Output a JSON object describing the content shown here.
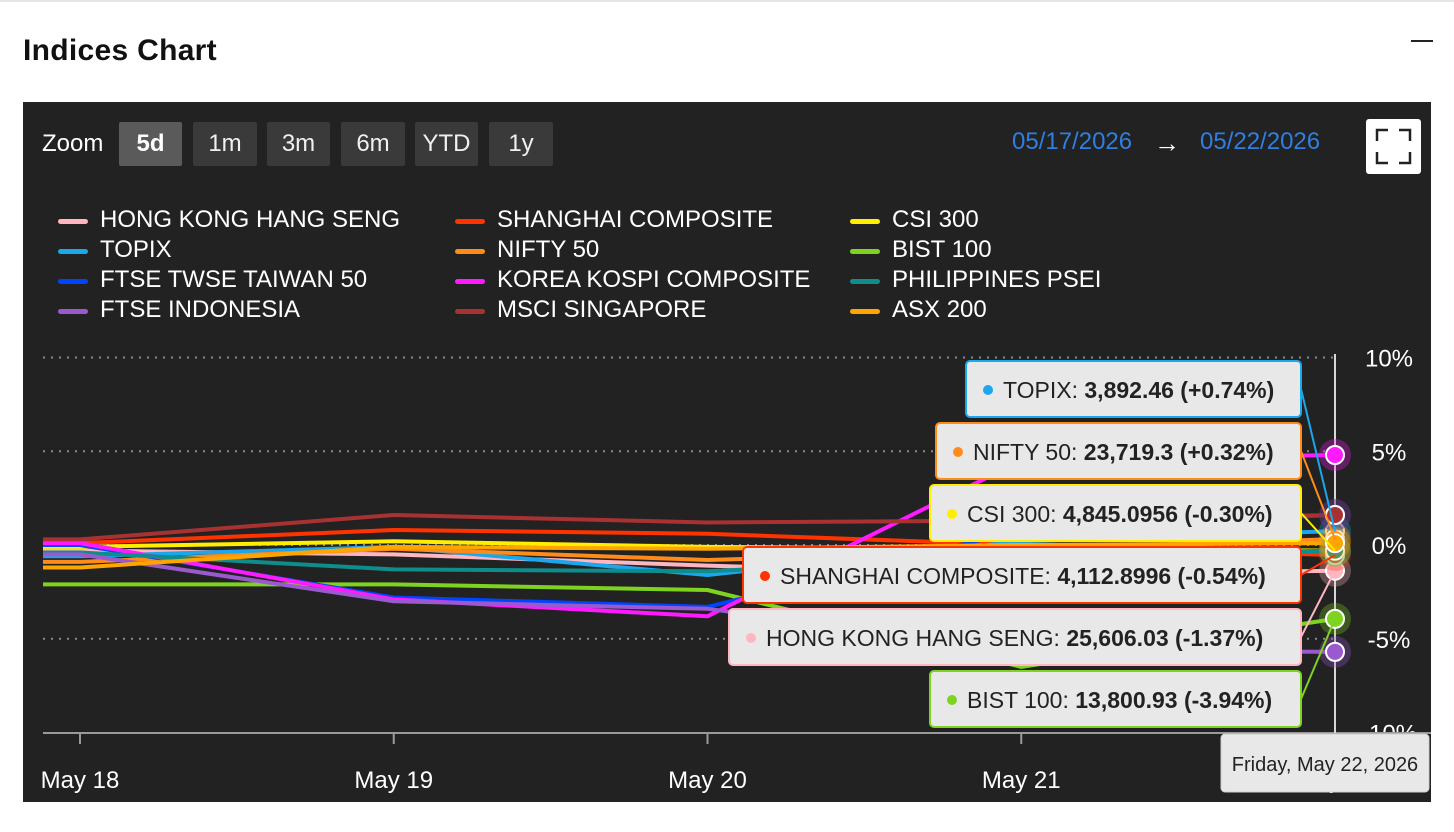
{
  "widget": {
    "title": "Indices Chart"
  },
  "zoom": {
    "label": "Zoom",
    "buttons": [
      "5d",
      "1m",
      "3m",
      "6m",
      "YTD",
      "1y"
    ],
    "active": "5d"
  },
  "date_range": {
    "from": "05/17/2026",
    "arrow": "→",
    "to": "05/22/2026"
  },
  "tooltip_date": "Friday, May 22, 2026",
  "chart_data": {
    "type": "line",
    "x": [
      "May 18",
      "May 19",
      "May 20",
      "May 21",
      "May 22"
    ],
    "y_ticks": [
      "10%",
      "5%",
      "0%",
      "-5%",
      "-10%"
    ],
    "ylim": [
      -10,
      10
    ],
    "grid": true,
    "legend_position": "top",
    "series": [
      {
        "name": "HONG KONG HANG SENG",
        "color": "#ffb6c1",
        "values": [
          -0.3,
          -0.5,
          -1.1,
          -1.6,
          -1.37
        ]
      },
      {
        "name": "SHANGHAI COMPOSITE",
        "color": "#ff3300",
        "values": [
          0.1,
          0.8,
          0.6,
          0.0,
          -0.54
        ]
      },
      {
        "name": "CSI 300",
        "color": "#ffee00",
        "values": [
          -0.1,
          0.2,
          -0.1,
          -0.2,
          -0.3
        ]
      },
      {
        "name": "TOPIX",
        "color": "#1aa7ec",
        "values": [
          -0.6,
          -0.1,
          -1.6,
          0.2,
          0.74
        ]
      },
      {
        "name": "NIFTY 50",
        "color": "#ff8c1a",
        "values": [
          -0.9,
          -0.2,
          -0.8,
          -0.3,
          0.32
        ]
      },
      {
        "name": "BIST 100",
        "color": "#7ed321",
        "values": [
          -2.1,
          -2.1,
          -2.4,
          -6.5,
          -3.94
        ]
      },
      {
        "name": "FTSE TWSE TAIWAN 50",
        "color": "#0044ff",
        "values": [
          0.0,
          -2.8,
          -3.3,
          0.8,
          1.6
        ]
      },
      {
        "name": "KOREA KOSPI COMPOSITE",
        "color": "#ff1aff",
        "values": [
          0.1,
          -2.9,
          -3.8,
          4.5,
          4.8
        ]
      },
      {
        "name": "PHILIPPINES PSEI",
        "color": "#0f8c8c",
        "values": [
          -0.4,
          -1.3,
          -1.4,
          -0.6,
          -0.3
        ]
      },
      {
        "name": "FTSE INDONESIA",
        "color": "#9b59d0",
        "values": [
          -0.5,
          -3.0,
          -3.4,
          -5.6,
          -5.7
        ]
      },
      {
        "name": "MSCI SINGAPORE",
        "color": "#a83232",
        "values": [
          0.3,
          1.6,
          1.2,
          1.3,
          1.6
        ]
      },
      {
        "name": "ASX 200",
        "color": "#ffa500",
        "values": [
          -1.2,
          -0.1,
          -0.2,
          0.0,
          0.1
        ]
      }
    ],
    "tooltips": [
      {
        "series": "TOPIX",
        "label": "TOPIX: ",
        "value": "3,892.46 (+0.74%)"
      },
      {
        "series": "NIFTY 50",
        "label": "NIFTY 50: ",
        "value": "23,719.3 (+0.32%)"
      },
      {
        "series": "CSI 300",
        "label": "CSI 300: ",
        "value": "4,845.0956 (-0.30%)"
      },
      {
        "series": "SHANGHAI COMPOSITE",
        "label": "SHANGHAI COMPOSITE: ",
        "value": "4,112.8996 (-0.54%)"
      },
      {
        "series": "HONG KONG HANG SENG",
        "label": "HONG KONG HANG SENG: ",
        "value": "25,606.03 (-1.37%)"
      },
      {
        "series": "BIST 100",
        "label": "BIST 100: ",
        "value": "13,800.93 (-3.94%)"
      }
    ]
  }
}
